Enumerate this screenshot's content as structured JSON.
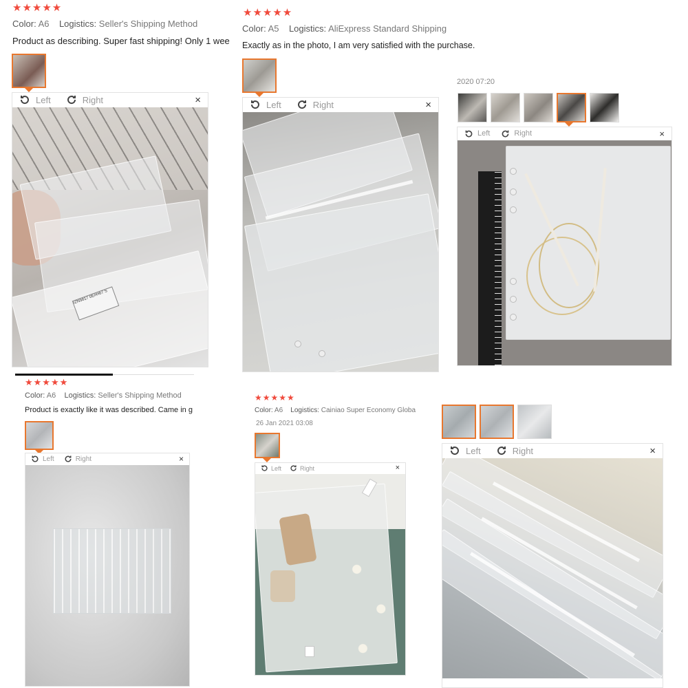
{
  "reviews": [
    {
      "stars": "★★★★★",
      "color_label": "Color:",
      "color_value": "A6",
      "logistics_label": "Logistics:",
      "logistics_value": "Seller's Shipping Method",
      "text": "Product as describing. Super fast shipping! Only 1 wee",
      "viewer": {
        "left_label": "Left",
        "right_label": "Right",
        "close": "×"
      },
      "photo_label": "IZN5817 0E#H67 S"
    },
    {
      "stars": "★★★★★",
      "color_label": "Color:",
      "color_value": "A5",
      "logistics_label": "Logistics:",
      "logistics_value": "AliExpress Standard Shipping",
      "text": "Exactly as in the photo, I am very satisfied with the purchase.",
      "viewer": {
        "left_label": "Left",
        "right_label": "Right",
        "close": "×"
      }
    },
    {
      "date": "2020 07:20",
      "viewer": {
        "left_label": "Left",
        "right_label": "Right",
        "close": "×"
      }
    },
    {
      "stars": "★★★★★",
      "color_label": "Color:",
      "color_value": "A6",
      "logistics_label": "Logistics:",
      "logistics_value": "Seller's Shipping Method",
      "text": "Product is exactly like it was described. Came in g",
      "viewer": {
        "left_label": "Left",
        "right_label": "Right",
        "close": "×"
      }
    },
    {
      "stars": "★★★★★",
      "color_label": "Color:",
      "color_value": "A6",
      "logistics_label": "Logistics:",
      "logistics_value": "Cainiao Super Economy Globa",
      "date": "26 Jan 2021 03:08",
      "viewer": {
        "left_label": "Left",
        "right_label": "Right",
        "close": "×"
      }
    },
    {
      "viewer": {
        "left_label": "Left",
        "right_label": "Right",
        "close": "×"
      }
    }
  ],
  "colors": {
    "star": "#f04a3c",
    "thumb_selected": "#e8772e"
  },
  "icons": {
    "rotate_left": "rotate-left-icon",
    "rotate_right": "rotate-right-icon",
    "close": "close-icon"
  }
}
